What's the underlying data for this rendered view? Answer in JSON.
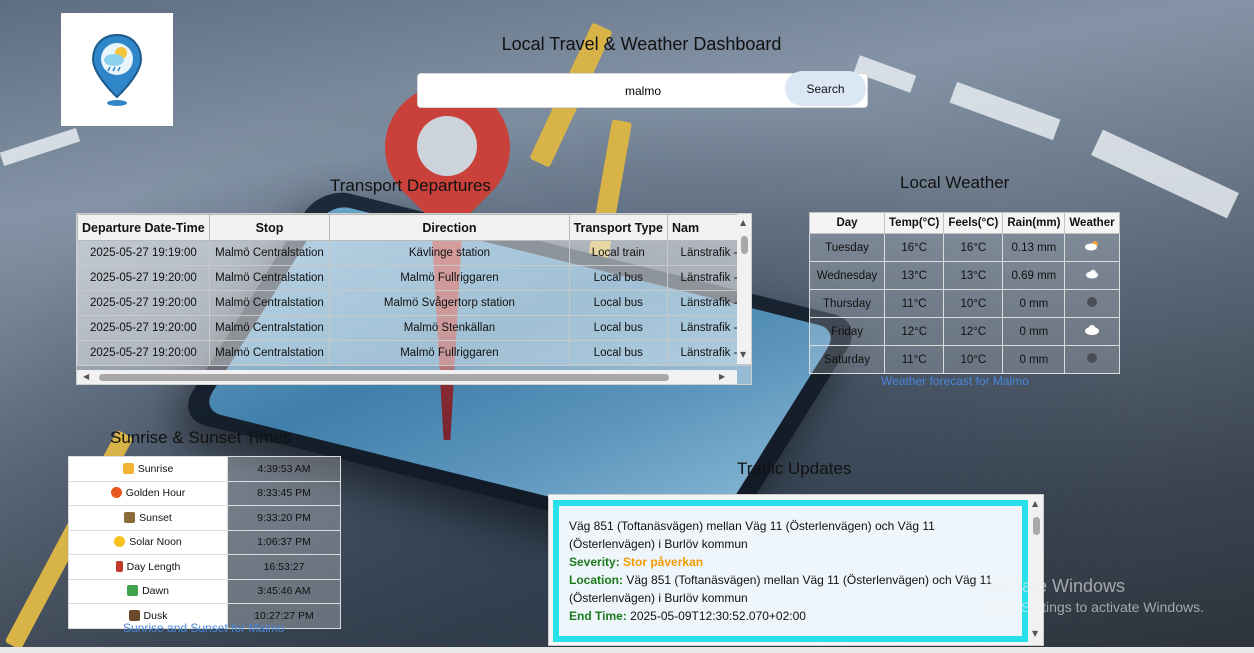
{
  "header": {
    "title": "Local Travel & Weather Dashboard",
    "search": {
      "value": "malmo",
      "button": "Search"
    }
  },
  "transport": {
    "title": "Transport Departures",
    "columns": [
      "Departure Date-Time",
      "Stop",
      "Direction",
      "Transport Type",
      "Nam"
    ],
    "rows": [
      [
        "2025-05-27 19:19:00",
        "Malmö Centralstation",
        "Kävlinge station",
        "Local train",
        "Länstrafik -"
      ],
      [
        "2025-05-27 19:20:00",
        "Malmö Centralstation",
        "Malmö Fullriggaren",
        "Local bus",
        "Länstrafik -"
      ],
      [
        "2025-05-27 19:20:00",
        "Malmö Centralstation",
        "Malmö Svågertorp station",
        "Local bus",
        "Länstrafik -"
      ],
      [
        "2025-05-27 19:20:00",
        "Malmö Centralstation",
        "Malmö Stenkällan",
        "Local bus",
        "Länstrafik -"
      ],
      [
        "2025-05-27 19:20:00",
        "Malmö Centralstation",
        "Malmö Fullriggaren",
        "Local bus",
        "Länstrafik -"
      ]
    ]
  },
  "weather": {
    "title": "Local Weather",
    "columns": [
      "Day",
      "Temp(°C)",
      "Feels(°C)",
      "Rain(mm)",
      "Weather"
    ],
    "rows": [
      {
        "day": "Tuesday",
        "temp": "16°C",
        "feels": "16°C",
        "rain": "0.13 mm",
        "icon": "rain-cloud-icon"
      },
      {
        "day": "Wednesday",
        "temp": "13°C",
        "feels": "13°C",
        "rain": "0.69 mm",
        "icon": "cloud-icon"
      },
      {
        "day": "Thursday",
        "temp": "11°C",
        "feels": "10°C",
        "rain": "0 mm",
        "icon": "dark-cloud-icon"
      },
      {
        "day": "Friday",
        "temp": "12°C",
        "feels": "12°C",
        "rain": "0 mm",
        "icon": "cloud-icon"
      },
      {
        "day": "Saturday",
        "temp": "11°C",
        "feels": "10°C",
        "rain": "0 mm",
        "icon": "dark-cloud-icon"
      }
    ],
    "link": "Weather forecast for Malmo"
  },
  "sun": {
    "title": "Sunrise & Sunset Times",
    "rows": [
      {
        "label": "Sunrise",
        "value": "4:39:53 AM",
        "icon": "sunrise-icon",
        "color": "#f2b233"
      },
      {
        "label": "Golden Hour",
        "value": "8:33:45 PM",
        "icon": "golden-hour-icon",
        "color": "#e8571e"
      },
      {
        "label": "Sunset",
        "value": "9:33:20 PM",
        "icon": "sunset-icon",
        "color": "#8a6a3a"
      },
      {
        "label": "Solar Noon",
        "value": "1:06:37 PM",
        "icon": "solar-noon-icon",
        "color": "#f6c21d"
      },
      {
        "label": "Day Length",
        "value": "16:53:27",
        "icon": "hourglass-icon",
        "color": "#c0392b"
      },
      {
        "label": "Dawn",
        "value": "3:45:46 AM",
        "icon": "dawn-icon",
        "color": "#3fa34d"
      },
      {
        "label": "Dusk",
        "value": "10:27:27 PM",
        "icon": "dusk-icon",
        "color": "#6b4a2a"
      }
    ],
    "link": "Sunrise and Sunset for Malmo"
  },
  "traffic": {
    "title": "Traffic Updates",
    "description": "Väg 851 (Toftanäsvägen) mellan Väg 11 (Österlenvägen) och Väg 11 (Österlenvägen) i Burlöv kommun",
    "severity_label": "Severity:",
    "severity_value": "Stor påverkan",
    "location_label": "Location:",
    "location_value": "Väg 851 (Toftanäsvägen) mellan Väg 11 (Österlenvägen) och Väg 11 (Österlenvägen) i Burlöv kommun",
    "end_label": "End Time:",
    "end_value": "2025-05-09T12:30:52.070+02:00"
  },
  "watermark": {
    "line1": "Activate Windows",
    "line2": "Go to Settings to activate Windows."
  },
  "colors": {
    "accent": "#27e0ea",
    "link": "#4a86d9",
    "severity": "#f29b00",
    "label_green": "#1b7a1b"
  }
}
